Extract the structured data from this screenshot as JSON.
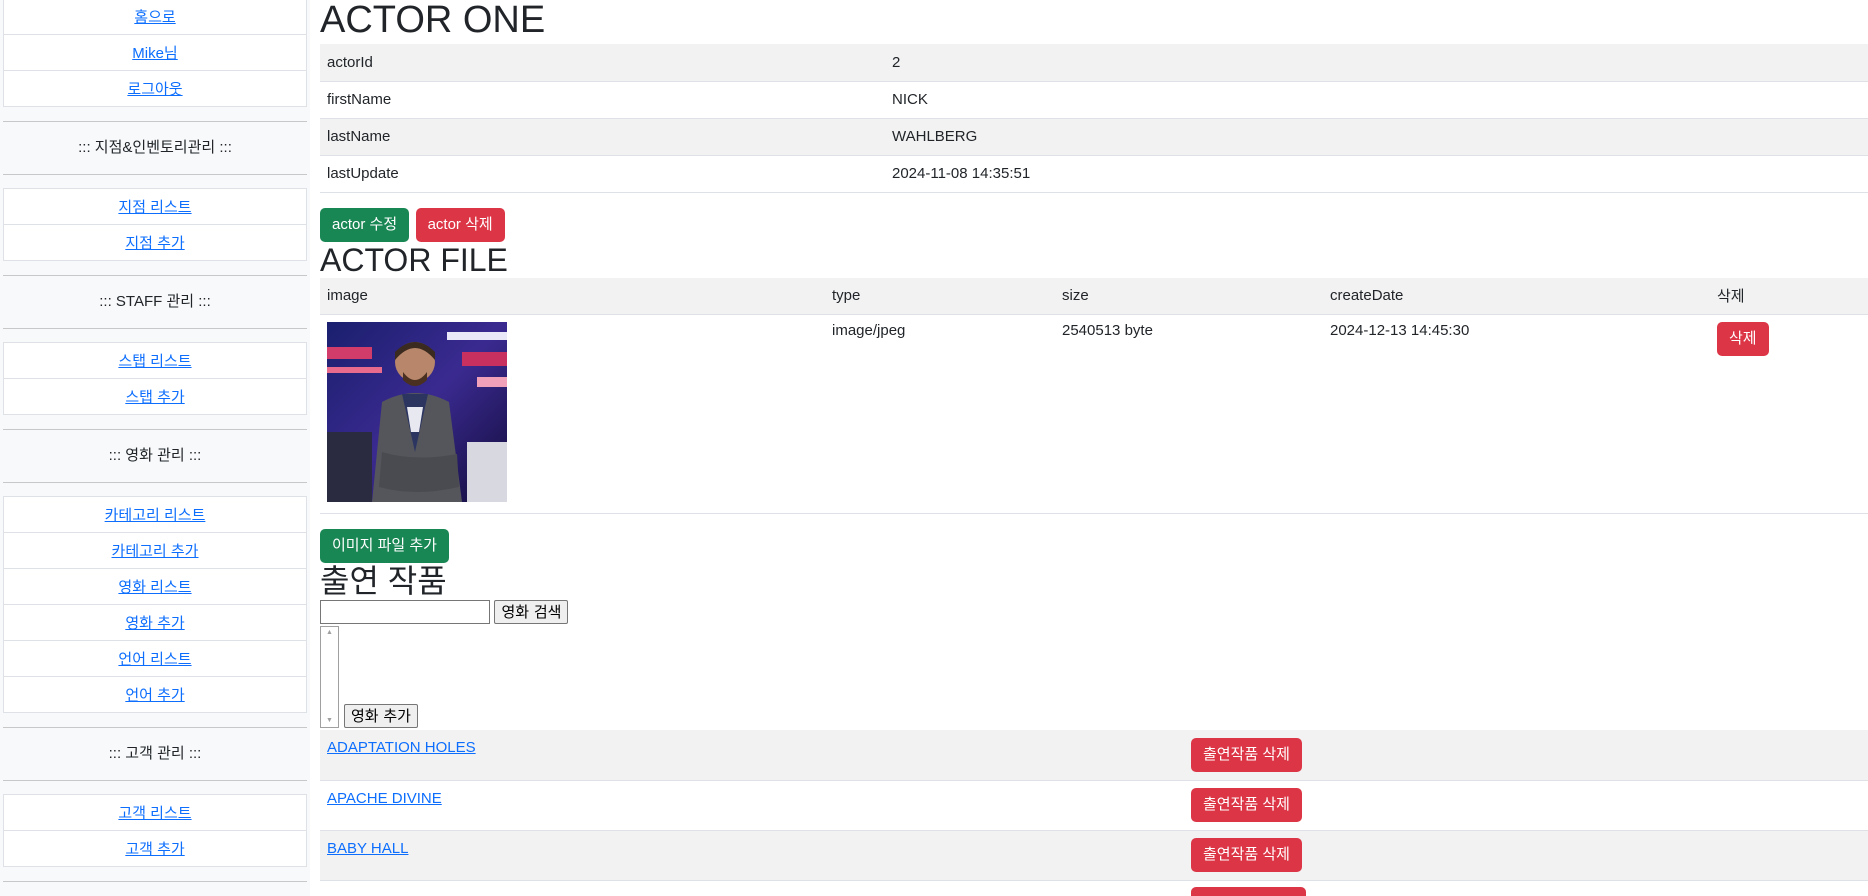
{
  "sidebar": {
    "top_links": [
      "홈으로",
      "Mike님",
      "로그아웃"
    ],
    "sections": [
      {
        "heading": "::: 지점&인벤토리관리 :::",
        "links": [
          "지점 리스트",
          "지점 추가"
        ]
      },
      {
        "heading": "::: STAFF 관리 :::",
        "links": [
          "스탭 리스트",
          "스탭 추가"
        ]
      },
      {
        "heading": "::: 영화 관리 :::",
        "links": [
          "카테고리 리스트",
          "카테고리 추가",
          "영화 리스트",
          "영화 추가",
          "언어 리스트",
          "언어 추가"
        ]
      },
      {
        "heading": "::: 고객 관리 :::",
        "links": [
          "고객 리스트",
          "고객 추가"
        ]
      }
    ]
  },
  "actor": {
    "title": "ACTOR ONE",
    "fields": [
      {
        "label": "actorId",
        "value": "2"
      },
      {
        "label": "firstName",
        "value": "NICK"
      },
      {
        "label": "lastName",
        "value": "WAHLBERG"
      },
      {
        "label": "lastUpdate",
        "value": "2024-11-08 14:35:51"
      }
    ],
    "edit_label": "actor 수정",
    "delete_label": "actor 삭제"
  },
  "files": {
    "title": "ACTOR FILE",
    "headers": [
      "image",
      "type",
      "size",
      "createDate",
      "삭제"
    ],
    "rows": [
      {
        "type": "image/jpeg",
        "size": "2540513 byte",
        "createDate": "2024-12-13 14:45:30",
        "delete_label": "삭제"
      }
    ],
    "add_label": "이미지 파일 추가"
  },
  "filmography": {
    "title": "출연 작품",
    "search_value": "",
    "search_label": "영화 검색",
    "add_label": "영화 추가",
    "films": [
      {
        "title": "ADAPTATION HOLES ",
        "delete_label": "출연작품 삭제"
      },
      {
        "title": "APACHE DIVINE ",
        "delete_label": "출연작품 삭제"
      },
      {
        "title": "BABY HALL ",
        "delete_label": "출연작품 삭제"
      },
      {
        "title": "",
        "delete_label": ""
      }
    ]
  },
  "colors": {
    "link": "#0d6efd",
    "success": "#198754",
    "danger": "#dc3545"
  }
}
